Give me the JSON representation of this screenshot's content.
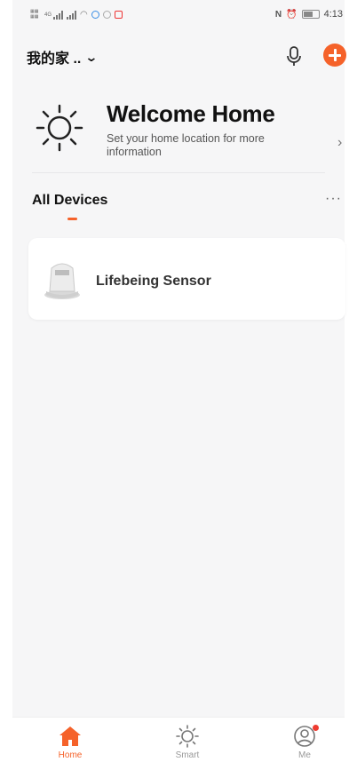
{
  "status_bar": {
    "time": "4:13",
    "net_label": "4G"
  },
  "header": {
    "home_name": "我的家 ..",
    "chevron": "⌄"
  },
  "welcome": {
    "title": "Welcome Home",
    "subtitle": "Set your home location for more information",
    "arrow": "›"
  },
  "devices": {
    "tab_label": "All Devices",
    "more_label": "···",
    "items": [
      {
        "name": "Lifebeing Sensor"
      }
    ]
  },
  "bottom_nav": [
    {
      "label": "Home",
      "icon": "home-icon",
      "active": true
    },
    {
      "label": "Smart",
      "icon": "sun-icon"
    },
    {
      "label": "Me",
      "icon": "user-icon"
    }
  ],
  "colors": {
    "accent": "#f5622a",
    "background": "#f6f6f7",
    "badge": "#ee3b30"
  }
}
